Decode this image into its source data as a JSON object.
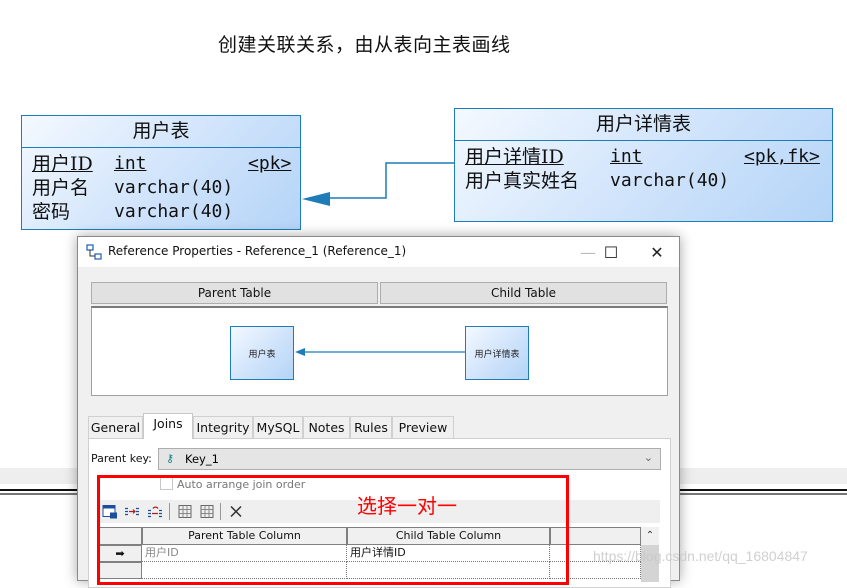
{
  "caption": "创建关联关系，由从表向主表画线",
  "diagram": {
    "parent_entity": {
      "name": "用户表",
      "columns": [
        {
          "name": "用户ID",
          "type": "int",
          "key": "<pk>",
          "underline": true
        },
        {
          "name": "用户名",
          "type": "varchar(40)",
          "key": "",
          "underline": false
        },
        {
          "name": "密码",
          "type": "varchar(40)",
          "key": "",
          "underline": false
        }
      ]
    },
    "child_entity": {
      "name": "用户详情表",
      "columns": [
        {
          "name": "用户详情ID",
          "type": "int",
          "key": "<pk,fk>",
          "underline": true
        },
        {
          "name": "用户真实姓名",
          "type": "varchar(40)",
          "key": "",
          "underline": false
        }
      ]
    },
    "reference_color": "#1e7cb8"
  },
  "dialog": {
    "title": "Reference Properties - Reference_1 (Reference_1)",
    "window_buttons": {
      "minimize": "—",
      "maximize": "☐",
      "close": "✕"
    },
    "parent_table_label": "Parent Table",
    "child_table_label": "Child Table",
    "preview": {
      "parent": "用户表",
      "child": "用户详情表"
    },
    "tabs": [
      {
        "label": "General",
        "active": false
      },
      {
        "label": "Joins",
        "active": true
      },
      {
        "label": "Integrity",
        "active": false
      },
      {
        "label": "MySQL",
        "active": false
      },
      {
        "label": "Notes",
        "active": false
      },
      {
        "label": "Rules",
        "active": false
      },
      {
        "label": "Preview",
        "active": false
      }
    ],
    "parent_key_label": "Parent key:",
    "parent_key_value": "Key_1",
    "auto_arrange_label": "Auto arrange join order",
    "auto_arrange_checked": false,
    "toolbar_icons": [
      "properties-icon",
      "reuse-columns-icon",
      "migrate-columns-icon",
      "insert-row-icon",
      "add-row-icon",
      "delete-icon"
    ],
    "grid": {
      "columns": [
        "Parent Table Column",
        "Child Table Column"
      ],
      "rows": [
        {
          "indicator": "➡",
          "parent": "用户ID",
          "child": "用户详情ID"
        },
        {
          "indicator": "",
          "parent": "",
          "child": ""
        }
      ]
    }
  },
  "annotation": {
    "text": "选择一对一",
    "color": "#ff0000"
  },
  "watermark": "https://blog.csdn.net/qq_16804847"
}
